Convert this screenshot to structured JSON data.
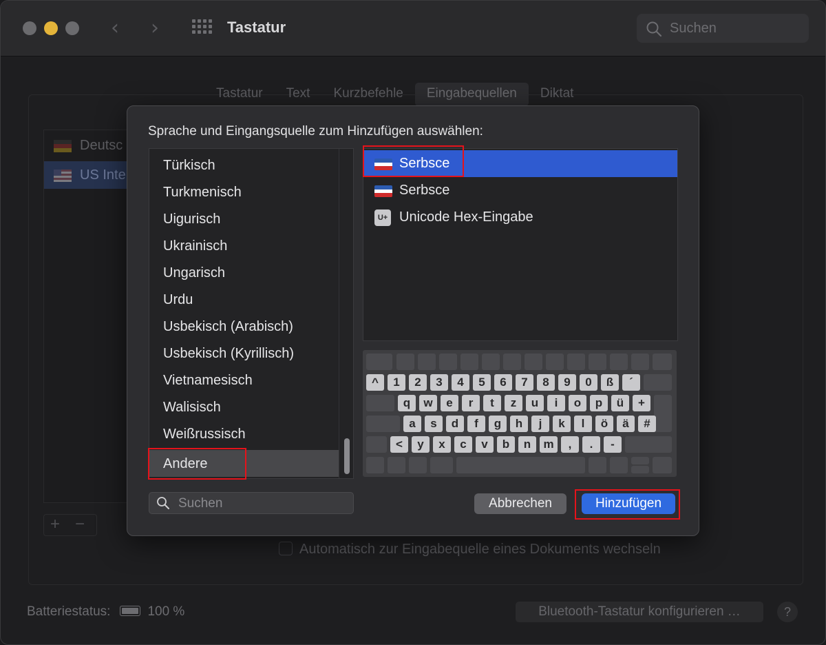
{
  "window": {
    "title": "Tastatur",
    "search_placeholder": "Suchen",
    "nav_back": "‹",
    "nav_forward": "›"
  },
  "tabs": [
    {
      "label": "Tastatur"
    },
    {
      "label": "Text"
    },
    {
      "label": "Kurzbefehle"
    },
    {
      "label": "Eingabequellen",
      "active": true
    },
    {
      "label": "Diktat"
    }
  ],
  "background": {
    "input_sources": [
      {
        "label": "Deutsch"
      },
      {
        "label": "US International – PC",
        "selected": true
      }
    ],
    "visible_labels": [
      "Deutsc",
      "US Inte"
    ],
    "add_symbol": "+",
    "remove_symbol": "−",
    "auto_switch_label": "Automatisch zur Eingabequelle eines Dokuments wechseln",
    "battery_label": "Batteriestatus:",
    "battery_value": "100 %",
    "bluetooth_button": "Bluetooth-Tastatur konfigurieren …",
    "help_symbol": "?"
  },
  "dialog": {
    "title": "Sprache und Eingangsquelle zum Hinzufügen auswählen:",
    "languages": [
      {
        "label": "Türkisch"
      },
      {
        "label": "Turkmenisch"
      },
      {
        "label": "Uigurisch"
      },
      {
        "label": "Ukrainisch"
      },
      {
        "label": "Ungarisch"
      },
      {
        "label": "Urdu"
      },
      {
        "label": "Usbekisch (Arabisch)"
      },
      {
        "label": "Usbekisch (Kyrillisch)"
      },
      {
        "label": "Vietnamesisch"
      },
      {
        "label": "Walisisch"
      },
      {
        "label": "Weißrussisch"
      },
      {
        "label": "Andere",
        "selected": true
      }
    ],
    "sources": [
      {
        "label": "Serbsce",
        "icon": "sorbian-flag-icon",
        "selected": true
      },
      {
        "label": "Serbsce",
        "icon": "sorbian-flag-icon"
      },
      {
        "label": "Unicode Hex-Eingabe",
        "icon": "unicode-hex-icon",
        "badge": "U+"
      }
    ],
    "keyboard": {
      "row1": [
        "^",
        "1",
        "2",
        "3",
        "4",
        "5",
        "6",
        "7",
        "8",
        "9",
        "0",
        "ß",
        "´"
      ],
      "row2": [
        "q",
        "w",
        "e",
        "r",
        "t",
        "z",
        "u",
        "i",
        "o",
        "p",
        "ü",
        "+"
      ],
      "row3": [
        "a",
        "s",
        "d",
        "f",
        "g",
        "h",
        "j",
        "k",
        "l",
        "ö",
        "ä",
        "#"
      ],
      "row4": [
        "<",
        "y",
        "x",
        "c",
        "v",
        "b",
        "n",
        "m",
        ",",
        ".",
        "-"
      ]
    },
    "search_placeholder": "Suchen",
    "cancel_label": "Abbrechen",
    "add_label": "Hinzufügen"
  },
  "colors": {
    "accent": "#2f6ae0",
    "selection": "#2f5bd0",
    "highlight_box": "#e5131b"
  }
}
